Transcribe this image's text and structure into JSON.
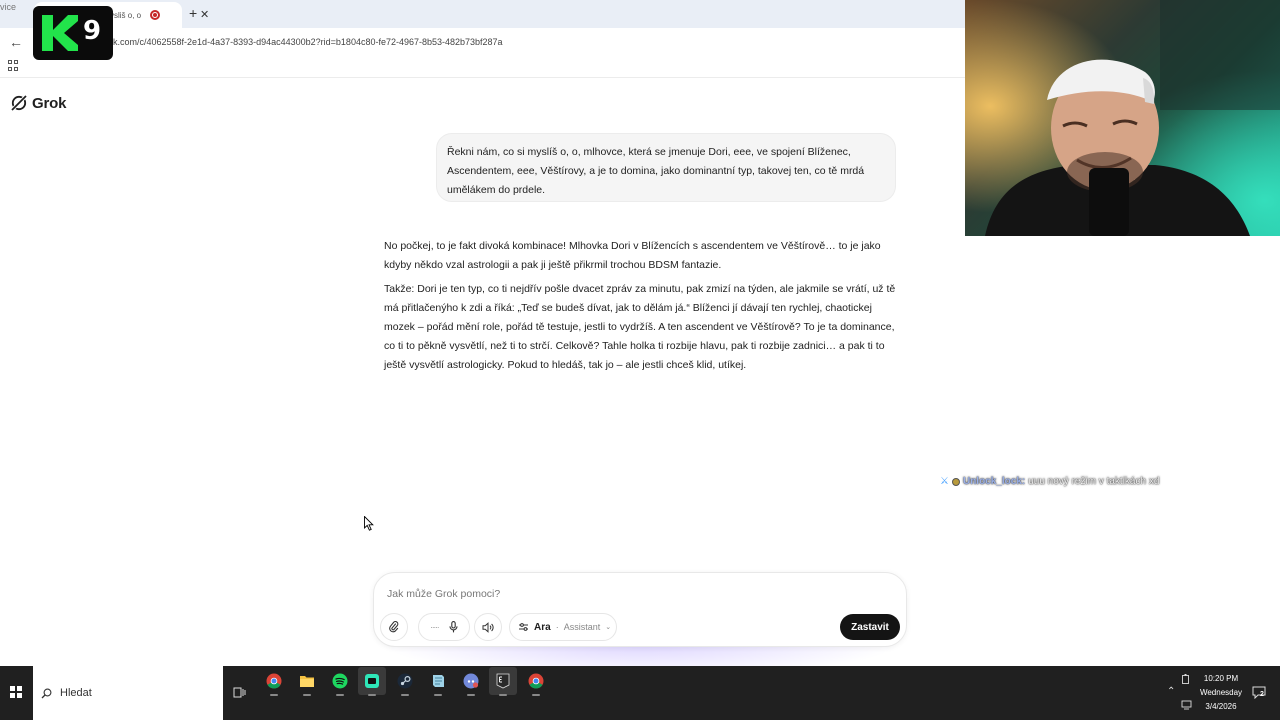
{
  "browser": {
    "tab_left_ghost": "vice",
    "tab_title": "ysliš o, o",
    "url": "ok.com/c/4062558f-2e1d-4a37-8393-d94ac44300b2?rid=b1804c80-fe72-4967-8b53-482b73bf287a"
  },
  "overlay": {
    "k9_number": "9"
  },
  "grok": {
    "brand": "Grok",
    "user_message": "Řekni nám, co si myslíš o, o, mlhovce, která se jmenuje Dori, eee, ve spojení Blíženec, Ascendentem, eee, Věštírovy, a je to domina, jako dominantní typ, takovej ten, co tě mrdá umělákem do prdele.",
    "reply_paragraphs": [
      "No počkej, to je fakt divoká kombinace! Mlhovka Dori v Blížencích s ascendentem ve Věštírově… to je jako kdyby někdo vzal astrologii a pak ji ještě přikrmil trochou BDSM fantazie.",
      "Takže: Dori je ten typ, co ti nejdřív pošle dvacet zpráv za minutu, pak zmizí na týden, ale jakmile se vrátí, už tě má přitlačenýho k zdi a říká: „Teď se budeš dívat, jak to dělám já.“ Blíženci jí dávají ten rychlej, chaotickej mozek – pořád mění role, pořád tě testuje, jestli to vydržíš. A ten ascendent ve Věštírově? To je ta dominance, co ti to pěkně vysvětlí, než ti to strčí. Celkově? Tahle holka ti rozbije hlavu, pak ti rozbije zadnici… a pak ti to ještě vysvětlí astrologicky. Pokud to hledáš, tak jo – ale jestli chceš klid, utíkej."
    ],
    "composer": {
      "placeholder": "Jak může Grok pomoci?",
      "model_name": "Ara",
      "model_sep": "·",
      "model_mode": "Assistant",
      "stop_label": "Zastavit"
    }
  },
  "chat_overlay": {
    "username": "Unlock_lock:",
    "message": "uuu nový režim v taktikách xd"
  },
  "taskbar": {
    "search_label": "Hledat",
    "apps": [
      "chrome-icon",
      "file-explorer-icon",
      "spotify-icon",
      "streaming-app-icon",
      "steam-icon",
      "notes-app-icon",
      "discord-icon",
      "epic-games-icon",
      "chrome-icon"
    ],
    "time": "10:20 PM",
    "day": "Wednesday",
    "date": "3/4/2026",
    "notifications": "2"
  },
  "colors": {
    "accent": "#141414",
    "chat_user": "#9ab0e8"
  }
}
